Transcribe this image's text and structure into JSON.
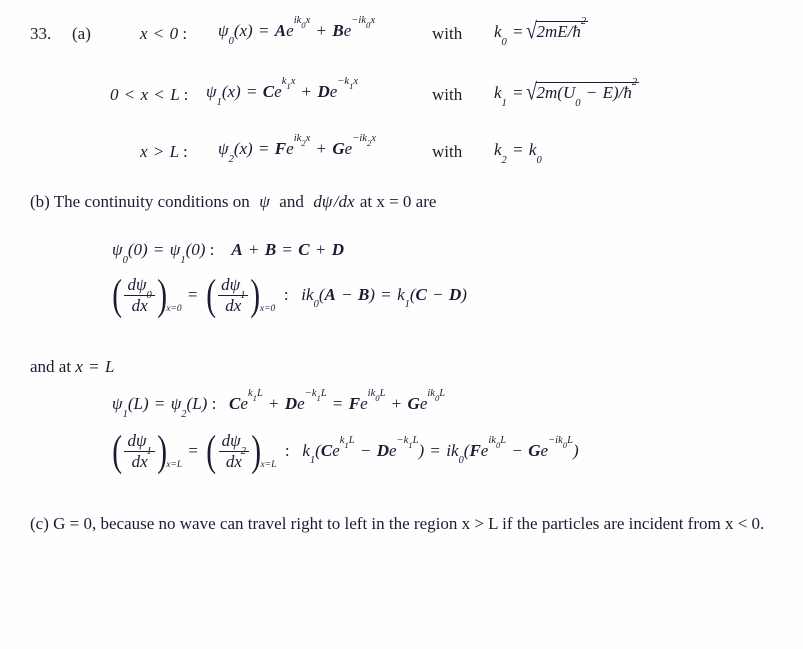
{
  "document": {
    "problem_number": "33.",
    "part_a_label": "(a)",
    "part_a": {
      "region1": {
        "condition": "x < 0 :",
        "wavefunction": "ψ0(x) = Ae^{ik0x} + Be^{−ik0x}",
        "with_label": "with",
        "constant": "k0 = √(2mE/ħ²)"
      },
      "region2": {
        "condition": "0 < x < L :",
        "wavefunction": "ψ1(x) = Ce^{k1x} + De^{−k1x}",
        "with_label": "with",
        "constant": "k1 = √(2m(U0 − E)/ħ²)"
      },
      "region3": {
        "condition": "x > L :",
        "wavefunction": "ψ2(x) = Fe^{ik2x} + Ge^{−ik2x}",
        "with_label": "with",
        "constant": "k2 = k0"
      }
    },
    "part_b": {
      "intro": "(b) The continuity conditions on ψ and dψ/dx at x = 0 are",
      "intro_prefix": "(b) The continuity conditions on",
      "intro_mid": "and",
      "intro_suffix": "at x = 0 are",
      "psi_symbol": "ψ",
      "derivative_symbol": "dψ/dx",
      "eq1": {
        "lhs": "ψ0(0) = ψ1(0) :",
        "rhs": "A + B = C + D"
      },
      "eq2": {
        "lhs": "(dψ0/dx)_{x=0} = (dψ1/dx)_{x=0} :",
        "rhs": "ik0(A − B) = k1(C − D)",
        "eval_point": "x=0"
      },
      "and_at": "and at x = L",
      "eq3": {
        "lhs": "ψ1(L) = ψ2(L) :",
        "rhs": "Ce^{k1L} + De^{−k1L} = Fe^{ik0L} + Ge^{ik0L}"
      },
      "eq4": {
        "lhs": "(dψ1/dx)_{x=L} = (dψ2/dx)_{x=L} :",
        "rhs": "k1(Ce^{k1L} − De^{−k1L}) = ik0(Fe^{ik0L} − Ge^{−ik0L})",
        "eval_point": "x=L"
      }
    },
    "part_c": {
      "text": "(c) G = 0, because no wave can travel right to left in the region x > L if the particles are incident from x < 0."
    },
    "colors": {
      "ink": "#1b1b33",
      "background": "#fefefe"
    }
  }
}
